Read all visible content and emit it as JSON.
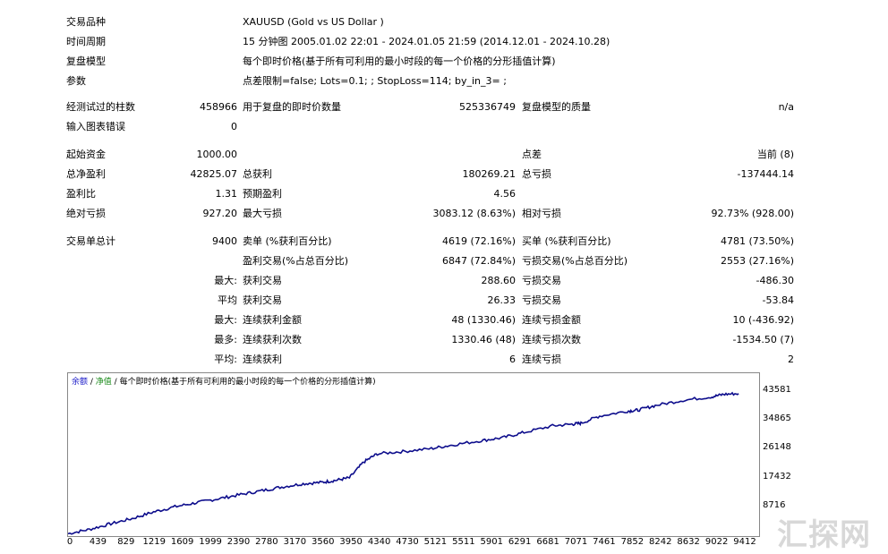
{
  "info": [
    {
      "label": "交易品种",
      "value": "XAUUSD (Gold vs US Dollar )"
    },
    {
      "label": "时间周期",
      "value": "15 分钟图 2005.01.02 22:01 - 2024.01.05 21:59 (2014.12.01 - 2024.10.28)"
    },
    {
      "label": "复盘模型",
      "value": "每个即时价格(基于所有可利用的最小时段的每一个价格的分形插值计算)"
    },
    {
      "label": "参数",
      "value": "点差限制=false; Lots=0.1; ; StopLoss=114; by_in_3= ;"
    }
  ],
  "bars": {
    "label": "经测试过的柱数",
    "value": "458966",
    "ticks_label": "用于复盘的即时价数量",
    "ticks_value": "525336749",
    "quality_label": "复盘模型的质量",
    "quality_value": "n/a"
  },
  "errors": {
    "label": "输入图表错误",
    "value": "0"
  },
  "deposit": {
    "label": "起始资金",
    "value": "1000.00",
    "spread_label": "点差",
    "spread_value": "当前 (8)"
  },
  "net": {
    "label": "总净盈利",
    "value": "42825.07",
    "gp_label": "总获利",
    "gp_value": "180269.21",
    "gl_label": "总亏损",
    "gl_value": "-137444.14"
  },
  "pf": {
    "label": "盈利比",
    "value": "1.31",
    "ep_label": "预期盈利",
    "ep_value": "4.56"
  },
  "dd": {
    "label": "绝对亏损",
    "value": "927.20",
    "max_label": "最大亏损",
    "max_value": "3083.12 (8.63%)",
    "rel_label": "相对亏损",
    "rel_value": "92.73% (928.00)"
  },
  "trades": {
    "label": "交易单总计",
    "value": "9400",
    "short_label": "卖单 (%获利百分比)",
    "short_value": "4619 (72.16%)",
    "long_label": "买单 (%获利百分比)",
    "long_value": "4781 (73.50%)"
  },
  "stats": [
    {
      "prefix": "",
      "a_label": "盈利交易(%占总百分比)",
      "a_value": "6847 (72.84%)",
      "b_label": "亏损交易(%占总百分比)",
      "b_value": "2553 (27.16%)"
    },
    {
      "prefix": "最大:",
      "a_label": "获利交易",
      "a_value": "288.60",
      "b_label": "亏损交易",
      "b_value": "-486.30"
    },
    {
      "prefix": "平均",
      "a_label": "获利交易",
      "a_value": "26.33",
      "b_label": "亏损交易",
      "b_value": "-53.84"
    },
    {
      "prefix": "最大:",
      "a_label": "连续获利金额",
      "a_value": "48 (1330.46)",
      "b_label": "连续亏损金额",
      "b_value": "10 (-436.92)"
    },
    {
      "prefix": "最多:",
      "a_label": "连续获利次数",
      "a_value": "1330.46 (48)",
      "b_label": "连续亏损次数",
      "b_value": "-1534.50 (7)"
    },
    {
      "prefix": "平均:",
      "a_label": "连续获利",
      "a_value": "6",
      "b_label": "连续亏损",
      "b_value": "2"
    }
  ],
  "legend": {
    "balance": "余额",
    "sep": " / ",
    "equity": "净值",
    "sep2": " / ",
    "model": "每个即时价格(基于所有可利用的最小时段的每一个价格的分形插值计算)"
  },
  "watermark": "汇探网",
  "colors": {
    "line": "#0d0d8c",
    "balance": "#1a1ac8",
    "equity": "#1a8a1a"
  },
  "chart_data": {
    "type": "line",
    "x_ticks": [
      "0",
      "439",
      "829",
      "1219",
      "1609",
      "1999",
      "2390",
      "2780",
      "3170",
      "3560",
      "3950",
      "4340",
      "4730",
      "5121",
      "5511",
      "5901",
      "6291",
      "6681",
      "7071",
      "7461",
      "7852",
      "8242",
      "8632",
      "9022",
      "9412"
    ],
    "y_ticks": [
      "43581",
      "34865",
      "26148",
      "17432",
      "8716"
    ],
    "series": [
      {
        "values_x": [
          0,
          300,
          600,
          900,
          1200,
          1500,
          1800,
          2100,
          2400,
          2700,
          3000,
          3300,
          3560,
          3750,
          3950,
          4150,
          4340,
          4700,
          5100,
          5400,
          5800,
          6100,
          6400,
          6800,
          7071,
          7200,
          7461,
          7852,
          8000,
          8242,
          8632,
          9022,
          9200,
          9412
        ],
        "values_y": [
          200,
          1500,
          3200,
          4800,
          6800,
          8400,
          9600,
          10800,
          12000,
          13200,
          14400,
          15400,
          15800,
          16400,
          17200,
          22000,
          24500,
          25200,
          26100,
          27200,
          28500,
          29400,
          31000,
          33000,
          33500,
          33800,
          36000,
          37500,
          37800,
          39200,
          40800,
          41800,
          42600,
          42825
        ]
      }
    ]
  }
}
